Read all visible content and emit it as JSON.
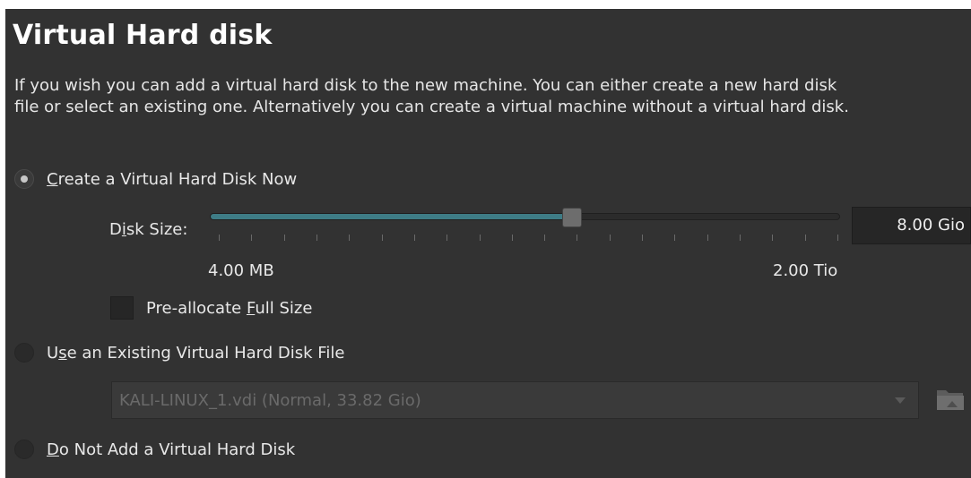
{
  "title": "Virtual Hard disk",
  "description": "If you wish you can add a virtual hard disk to the new machine. You can either create a new hard disk file or select an existing one. Alternatively you can create a virtual machine without a virtual hard disk.",
  "options": {
    "create_now": {
      "pre": "",
      "ul": "C",
      "post": "reate a Virtual Hard Disk Now",
      "selected": true
    },
    "use_existing": {
      "pre": "U",
      "ul": "s",
      "post": "e an Existing Virtual Hard Disk File",
      "selected": false
    },
    "do_not_add": {
      "pre": "",
      "ul": "D",
      "post": "o Not Add a Virtual Hard Disk",
      "selected": false
    }
  },
  "disk_size": {
    "label_pre": "D",
    "label_ul": "i",
    "label_post": "sk Size:",
    "value": "8.00 Gio",
    "min_label": "4.00 MB",
    "max_label": "2.00 Tio",
    "slider_fraction": 0.575,
    "tick_count": 20
  },
  "preallocate": {
    "pre": "Pre-allocate ",
    "ul": "F",
    "post": "ull Size",
    "checked": false
  },
  "existing_file": {
    "selected": "KALI-LINUX_1.vdi (Normal, 33.82 Gio)"
  },
  "icons": {
    "folder": "folder-open-icon",
    "combo": "chevron-down-icon"
  },
  "colors": {
    "background": "#323232",
    "slider_fill": "#3e7c86"
  }
}
